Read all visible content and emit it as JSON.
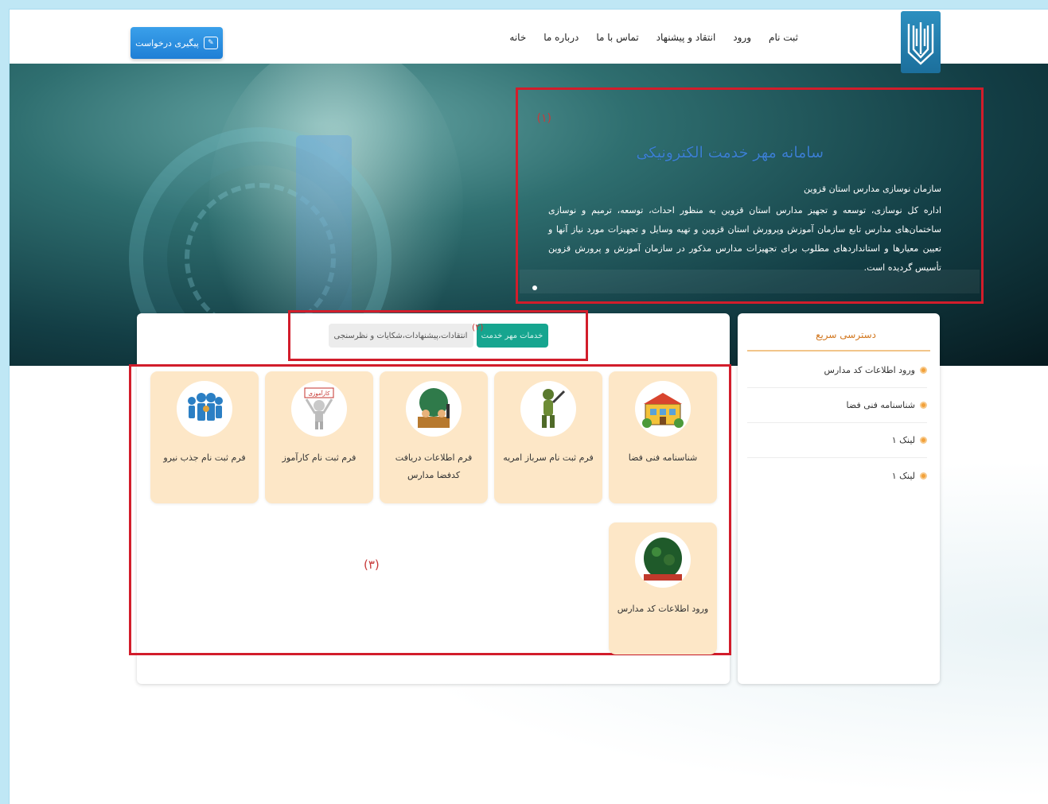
{
  "nav": {
    "items": [
      "خانه",
      "درباره ما",
      "تماس با ما",
      "انتقاد و پیشنهاد",
      "ورود",
      "ثبت نام"
    ]
  },
  "header": {
    "track_button": "پیگیری درخواست"
  },
  "hero": {
    "marker": "(۱)",
    "title": "سامانه مهر خدمت الکترونیکی",
    "subtitle": "سازمان نوسازی مدارس استان قزوین",
    "description": "اداره کل نوسازی، توسعه و تجهیز مدارس استان قزوین به منظور احداث، توسعه، ترمیم و نوسازی ساختمان‌های مدارس تابع سازمان آموزش وپرورش استان قزوین و تهیه وسایل و تجهیزات مورد نیاز آنها و تعیین معیارها و استانداردهای مطلوب برای تجهیزات مدارس مذکور در سازمان آموزش و پرورش قزوین تأسیس گردیده است."
  },
  "tabs": {
    "marker": "(۲)",
    "active": "خدمات مهر خدمت",
    "inactive": "انتقادات،پیشنهادات،شکایات و نظرسنجی"
  },
  "services": {
    "marker": "(۳)",
    "items": [
      {
        "label": "شناسنامه فنی فضا",
        "icon": "school-building-icon"
      },
      {
        "label": "فرم ثبت نام سرباز امریه",
        "icon": "soldier-icon"
      },
      {
        "label": "فرم اطلاعات دریافت کدفضا مدارس",
        "icon": "classroom-icon"
      },
      {
        "label": "فرم ثبت نام کارآموز",
        "icon": "intern-icon",
        "badge": "کارآموزی"
      },
      {
        "label": "فرم ثبت نام جذب نیرو",
        "icon": "people-group-icon"
      },
      {
        "label": "ورود اطلاعات کد مدارس",
        "icon": "tree-icon"
      }
    ]
  },
  "sidebar": {
    "title": "دسترسی سریع",
    "items": [
      "ورود اطلاعات کد مدارس",
      "شناسنامه فنی فضا",
      "لینک ۱",
      "لینک ۱"
    ]
  },
  "colors": {
    "accent": "#16a58f",
    "annotation_red": "#d21d2b",
    "card_bg": "#fde7c7",
    "header_button": "#1f7fd6"
  }
}
